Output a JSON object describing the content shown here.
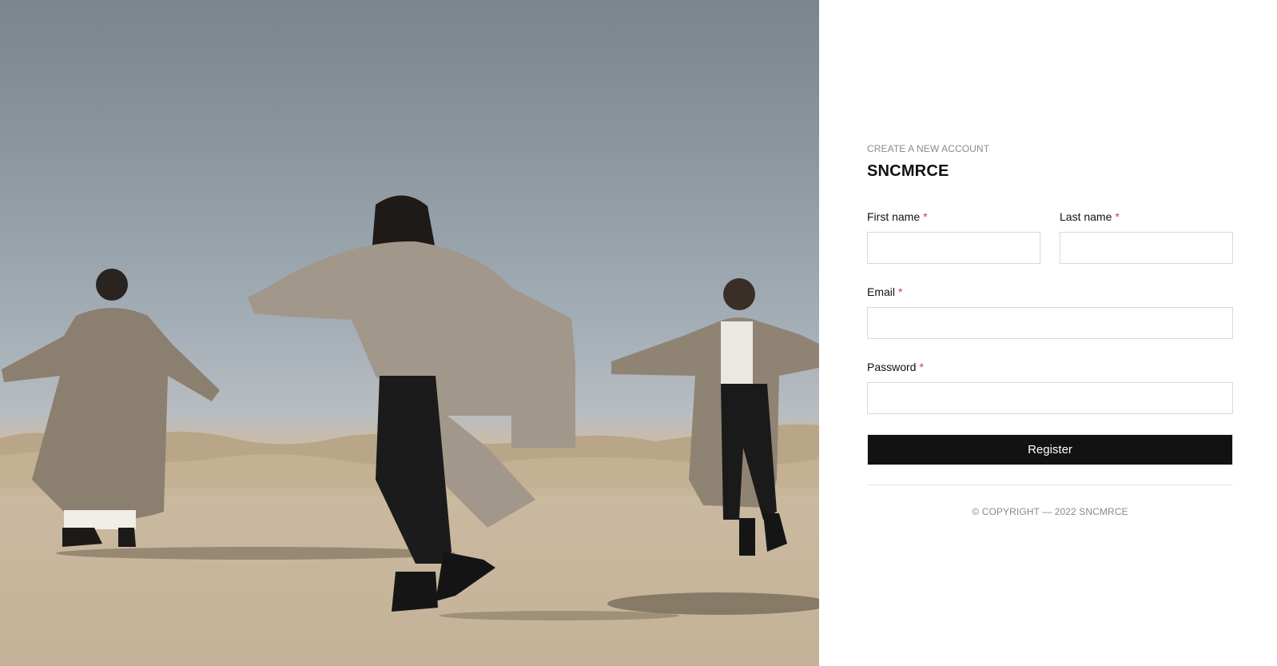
{
  "hero": {
    "image": "three-figures-in-trench-coats-dancing-in-desert"
  },
  "form": {
    "eyebrow": "CREATE A NEW ACCOUNT",
    "brand": "SNCMRCE",
    "first_name": {
      "label": "First name",
      "required_mark": "*",
      "value": ""
    },
    "last_name": {
      "label": "Last name",
      "required_mark": "*",
      "value": ""
    },
    "email": {
      "label": "Email",
      "required_mark": "*",
      "value": ""
    },
    "password": {
      "label": "Password",
      "required_mark": "*",
      "value": ""
    },
    "submit_label": "Register"
  },
  "footer": {
    "copyright": "© COPYRIGHT — 2022 SNCMRCE"
  },
  "colors": {
    "button_bg": "#121212",
    "required": "#d23a3a",
    "muted_text": "#8a8a8a",
    "input_border": "#d9d9d9"
  }
}
